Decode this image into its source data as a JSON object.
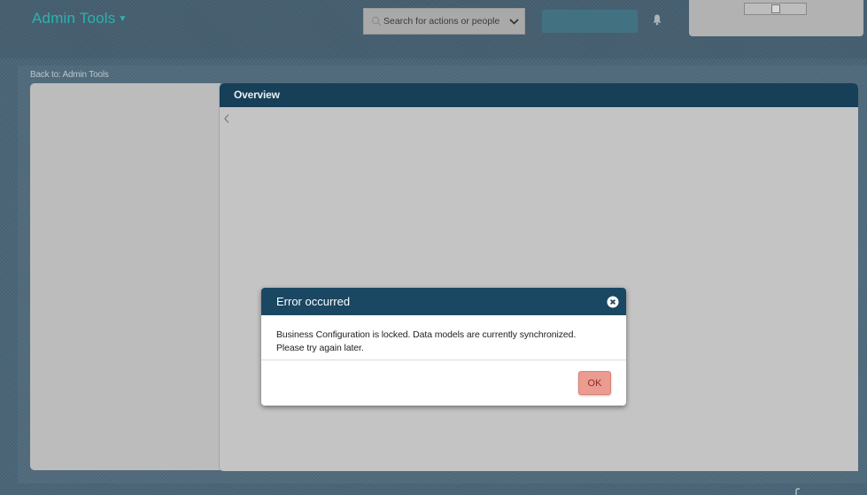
{
  "header": {
    "brand_label": "Admin Tools",
    "search_placeholder": "Search for actions or people",
    "icons": [
      "search-icon",
      "chevron-down-icon",
      "bell-icon",
      "broken-image-icon"
    ]
  },
  "breadcrumb": {
    "back_label": "Back to: Admin Tools"
  },
  "panel": {
    "title": "Overview"
  },
  "dialog": {
    "title": "Error occurred",
    "message_line1": "Business Configuration is locked. Data models are currently synchronized.",
    "message_line2": "Please try again later.",
    "ok_label": "OK"
  },
  "colors": {
    "brand": "#2bb3b0",
    "header_dark": "#173f58",
    "dialog_header": "#1a4762",
    "ok_button": "#ec9b91",
    "ok_text": "#8e2a1f"
  }
}
